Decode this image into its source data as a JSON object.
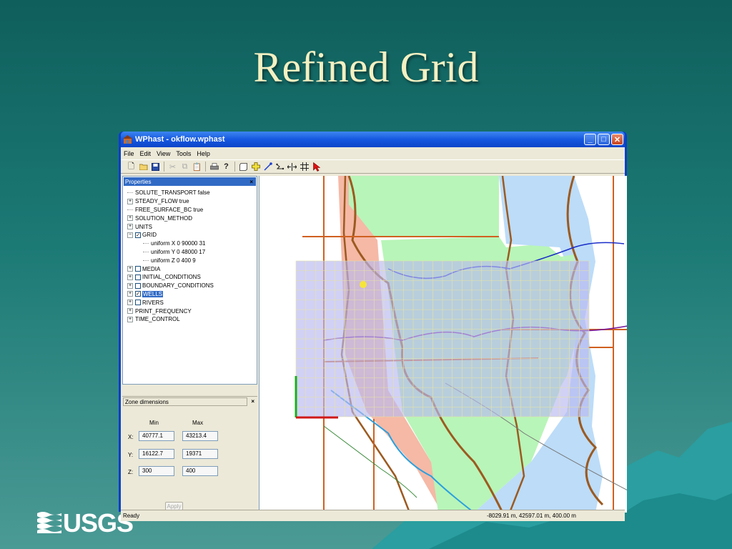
{
  "slide": {
    "title": "Refined Grid",
    "logo_text": "USGS"
  },
  "window": {
    "title": "WPhast - okflow.wphast",
    "controls": {
      "minimize": "_",
      "maximize": "□",
      "close": "✕"
    }
  },
  "menu": [
    "File",
    "Edit",
    "View",
    "Tools",
    "Help"
  ],
  "toolbar_icons": [
    "new-icon",
    "open-icon",
    "save-icon",
    "cut-icon",
    "copy-icon",
    "paste-icon",
    "print-icon",
    "help-icon",
    "new-zone-icon",
    "add-icon",
    "well-icon",
    "river-icon",
    "pan-icon",
    "grid-icon",
    "select-arrow-icon"
  ],
  "properties": {
    "header": "Properties",
    "close": "×",
    "tree": [
      {
        "label": "SOLUTE_TRANSPORT false",
        "type": "line",
        "indent": 0
      },
      {
        "label": "STEADY_FLOW true",
        "type": "expand",
        "indent": 0
      },
      {
        "label": "FREE_SURFACE_BC true",
        "type": "line",
        "indent": 0
      },
      {
        "label": "SOLUTION_METHOD",
        "type": "expand",
        "indent": 0
      },
      {
        "label": "UNITS",
        "type": "expand",
        "indent": 0
      },
      {
        "label": "GRID",
        "type": "collapse-check",
        "checked": true,
        "indent": 0
      },
      {
        "label": "uniform X 0 90000 31",
        "type": "line",
        "indent": 1
      },
      {
        "label": "uniform Y 0 48000 17",
        "type": "line",
        "indent": 1
      },
      {
        "label": "uniform Z 0 400 9",
        "type": "line",
        "indent": 1
      },
      {
        "label": "MEDIA",
        "type": "expand-check",
        "checked": false,
        "indent": 0
      },
      {
        "label": "INITIAL_CONDITIONS",
        "type": "expand-check",
        "checked": false,
        "indent": 0
      },
      {
        "label": "BOUNDARY_CONDITIONS",
        "type": "expand-check",
        "checked": false,
        "indent": 0
      },
      {
        "label": "WELLS",
        "type": "expand-check",
        "checked": true,
        "selected": true,
        "indent": 0
      },
      {
        "label": "RIVERS",
        "type": "expand-check",
        "checked": false,
        "indent": 0
      },
      {
        "label": "PRINT_FREQUENCY",
        "type": "expand",
        "indent": 0
      },
      {
        "label": "TIME_CONTROL",
        "type": "expand",
        "indent": 0
      }
    ]
  },
  "zone": {
    "header": "Zone dimensions",
    "close": "×",
    "min_label": "Min",
    "max_label": "Max",
    "x_label": "X:",
    "y_label": "Y:",
    "z_label": "Z:",
    "x_min": "40777.1",
    "x_max": "43213.4",
    "y_min": "16122.7",
    "y_max": "19371",
    "z_min": "300",
    "z_max": "400",
    "apply": "Apply"
  },
  "status": {
    "text": "Ready",
    "coords": "-8029.91 m, 42597.01 m, 400.00 m"
  },
  "colors": {
    "grid_overlay": "#b9b9f0",
    "green_region": "#b8f5b8",
    "blue_region": "#bcdcf8",
    "salmon_region": "#f5b9a6"
  }
}
